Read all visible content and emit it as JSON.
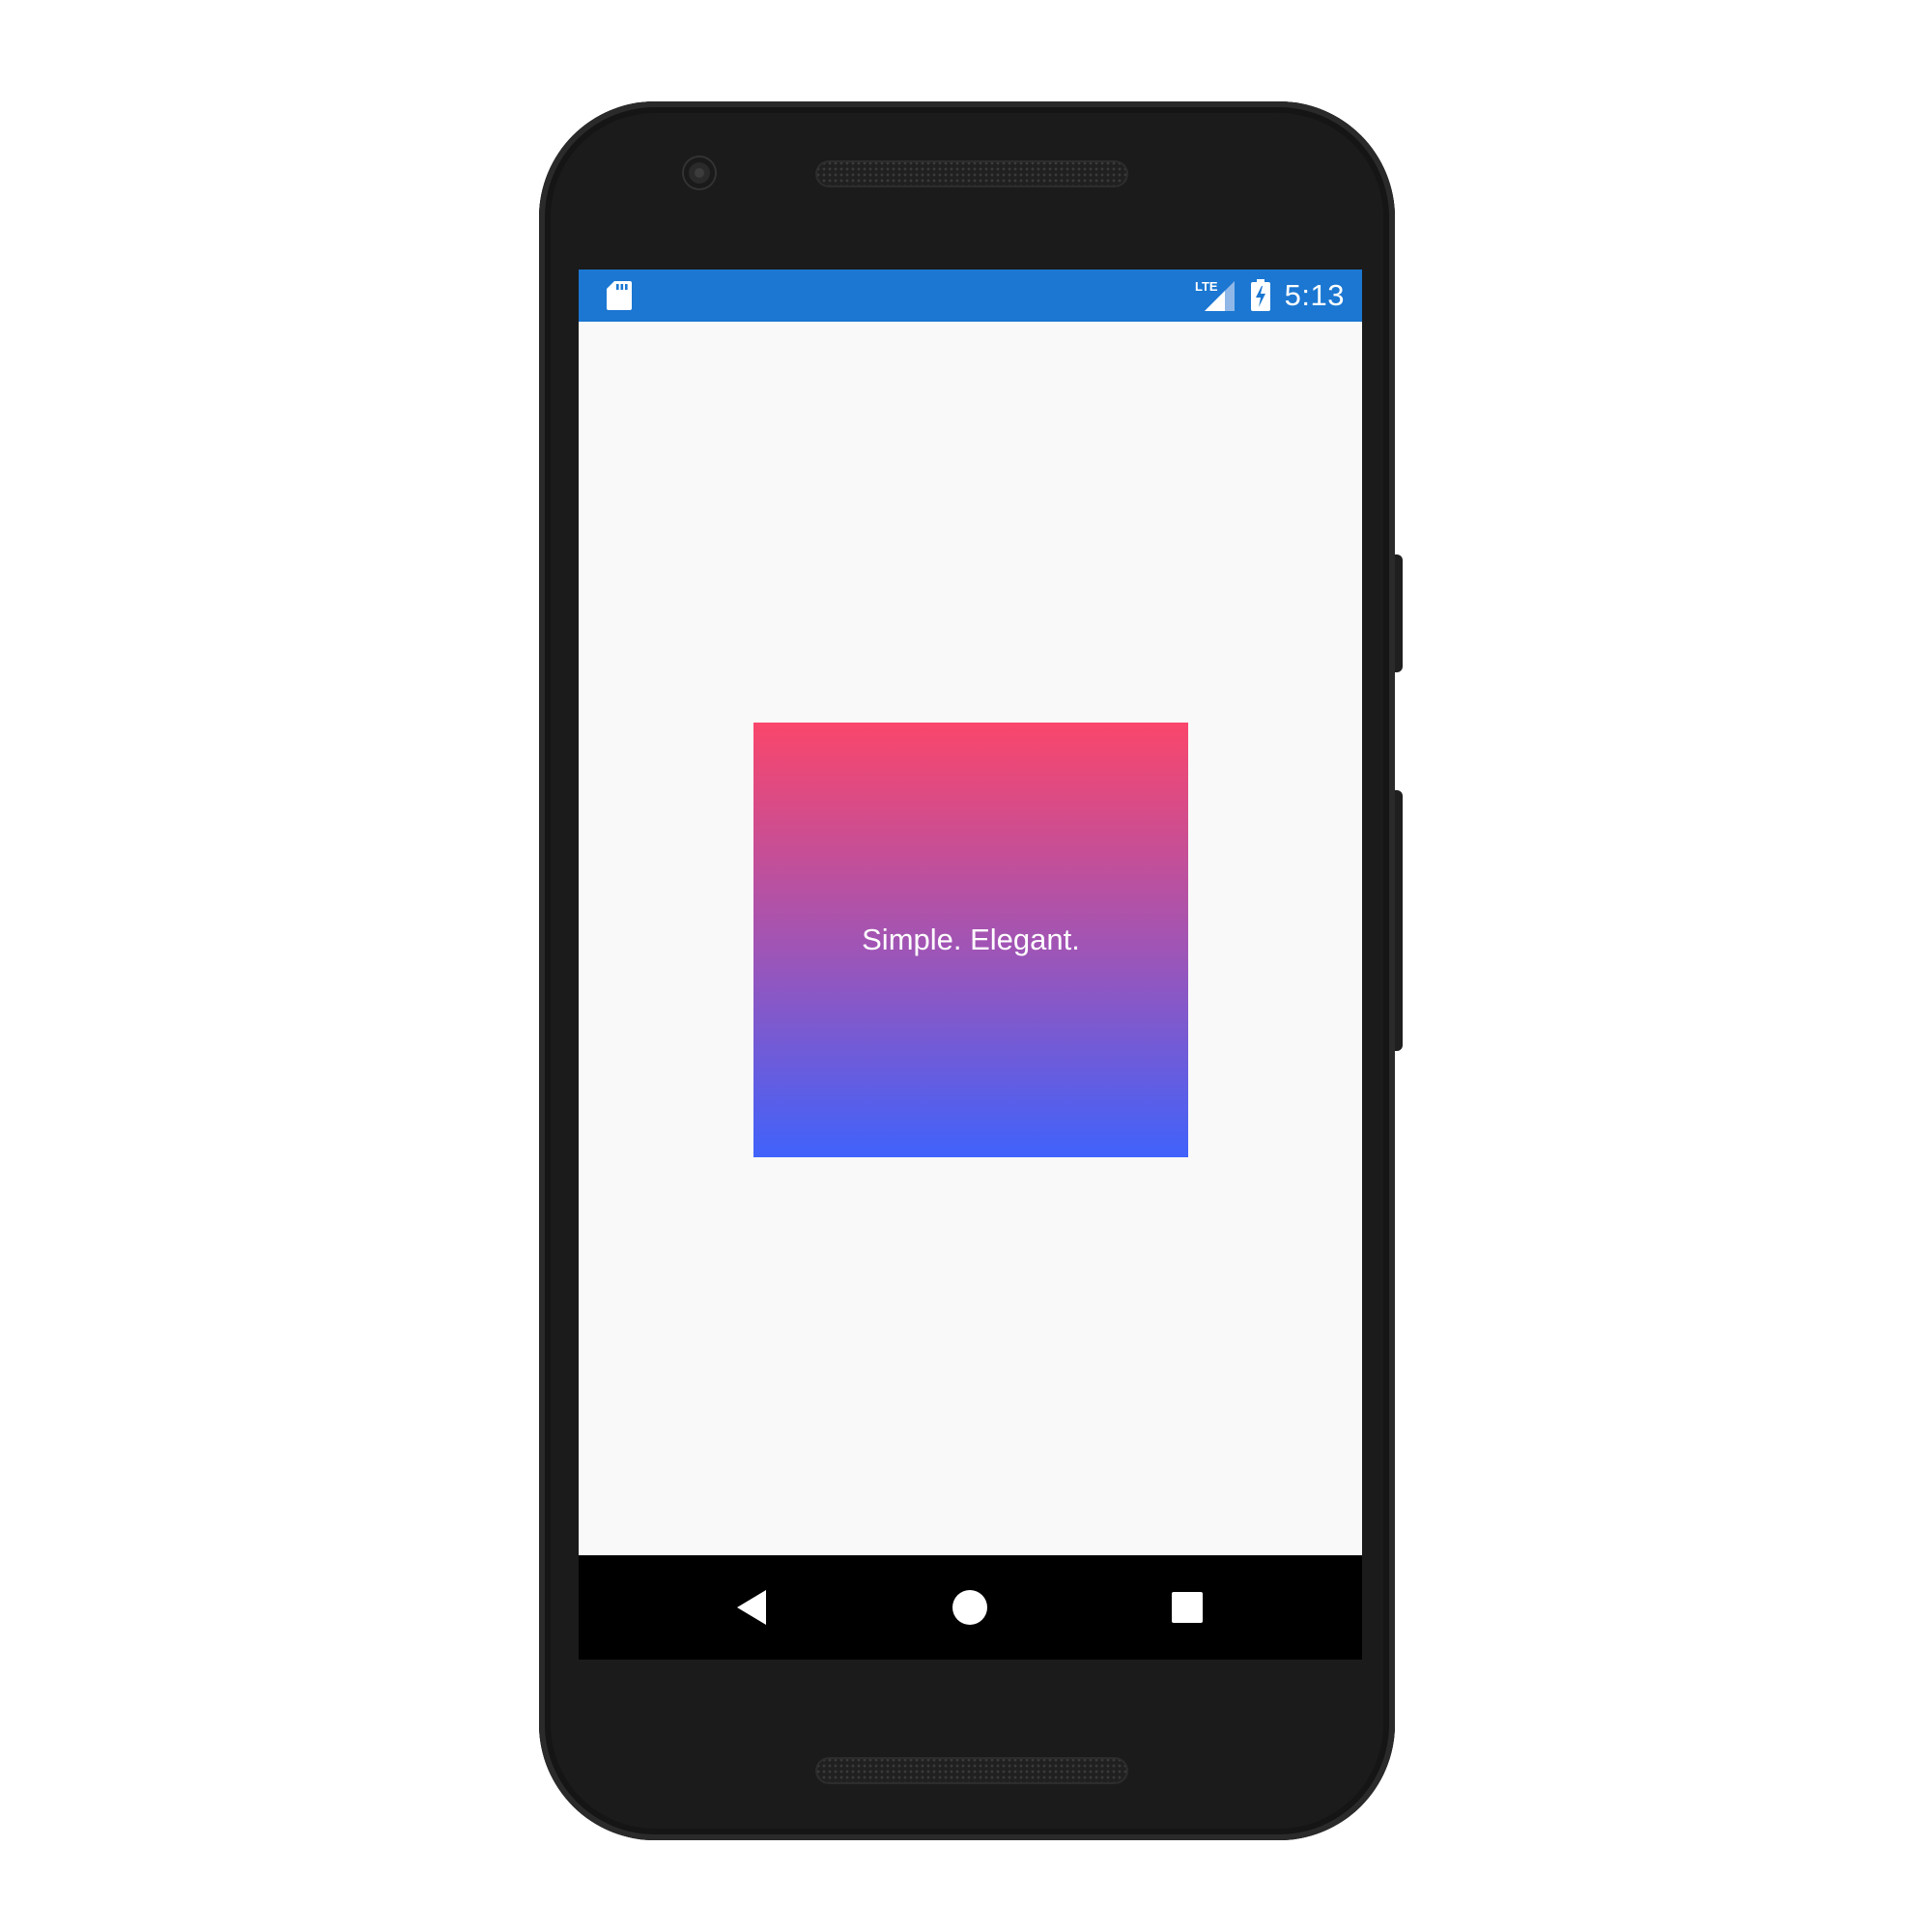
{
  "status_bar": {
    "time": "5:13",
    "network_label": "LTE",
    "color": "#1b77d2",
    "icons": [
      "sd-card-icon",
      "lte-signal-icon",
      "battery-charging-icon"
    ]
  },
  "content": {
    "card_text": "Simple. Elegant.",
    "gradient_colors": [
      "#fa466b",
      "#a354b3",
      "#4062fb"
    ],
    "background": "#f9f9f9"
  },
  "nav_bar": {
    "icons": [
      "back-icon",
      "home-icon",
      "recents-icon"
    ]
  }
}
